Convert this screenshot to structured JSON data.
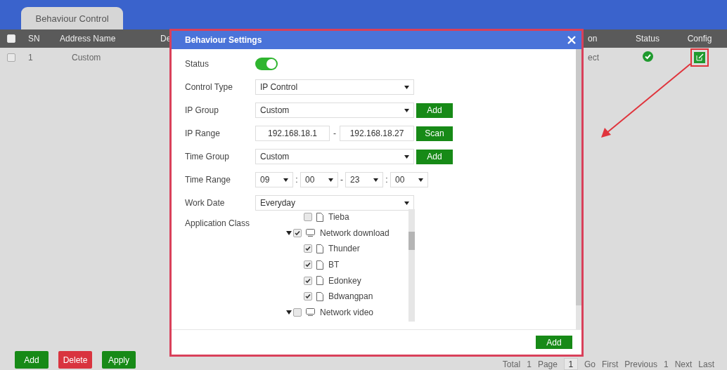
{
  "tab": {
    "label": "Behaviour Control",
    "selected": true
  },
  "table": {
    "select_all": {
      "checked": false
    },
    "columns": [
      "SN",
      "Address Name",
      "De",
      "on",
      "Status",
      "Config"
    ],
    "rows": [
      {
        "checked": false,
        "sn": "1",
        "address_name": "Custom",
        "column_4": "ect",
        "enabled": true
      }
    ]
  },
  "dialog": {
    "title": "Behaviour Settings",
    "fields": [
      {
        "kind": "toggle",
        "label": "Status",
        "on": true
      },
      {
        "kind": "select",
        "label": "Control Type",
        "value": "IP Control"
      },
      {
        "kind": "select_add",
        "label": "IP Group",
        "value": "Custom",
        "button": "Add"
      },
      {
        "kind": "ip_range",
        "label": "IP Range",
        "start": "192.168.18.1",
        "separator": "-",
        "end": "192.168.18.27",
        "button": "Scan"
      },
      {
        "kind": "select_add",
        "label": "Time Group",
        "value": "Custom",
        "button": "Add"
      },
      {
        "kind": "time_range",
        "label": "Time Range",
        "values": [
          "09",
          "00",
          "23",
          "00"
        ],
        "separators": [
          ":",
          "-",
          ":"
        ]
      },
      {
        "kind": "select",
        "label": "Work Date",
        "value": "Everyday"
      },
      {
        "kind": "tree",
        "label": "Application Class",
        "items": [
          {
            "kind": "app",
            "label": "Tieba",
            "checked": false
          },
          {
            "kind": "category",
            "label": "Network download",
            "checked": true,
            "expanded": true,
            "children": [
              {
                "kind": "app",
                "label": "Thunder",
                "checked": true
              },
              {
                "kind": "app",
                "label": "BT",
                "checked": true
              },
              {
                "kind": "app",
                "label": "Edonkey",
                "checked": true
              },
              {
                "kind": "app",
                "label": "Bdwangpan",
                "checked": true
              }
            ]
          },
          {
            "kind": "category",
            "label": "Network video",
            "checked": false,
            "expanded": true
          }
        ]
      }
    ],
    "footer_button": "Add"
  },
  "bottom": {
    "buttons": [
      {
        "label": "Add",
        "kind": "primary"
      },
      {
        "label": "Delete",
        "kind": "danger"
      },
      {
        "label": "Apply",
        "kind": "primary"
      }
    ],
    "pagination": {
      "total_label": "Total",
      "total": "1",
      "page_label": "Page",
      "page": "1",
      "go": "Go",
      "first": "First",
      "previous": "Previous",
      "current": "1",
      "next": "Next",
      "last": "Last"
    }
  }
}
